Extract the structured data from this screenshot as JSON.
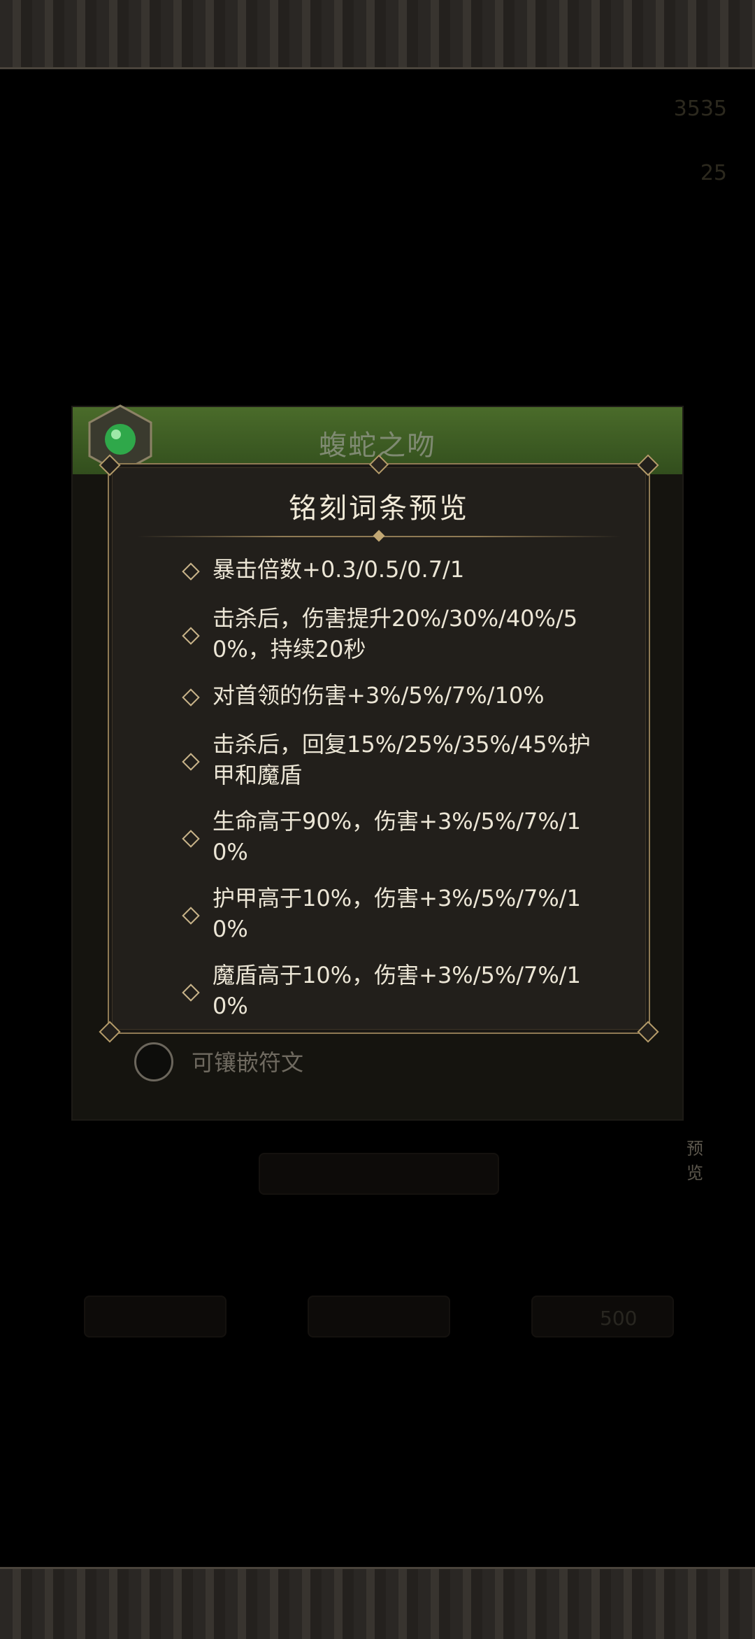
{
  "background": {
    "currency_1": "3535",
    "currency_2": "25",
    "equip_title": "蝮蛇之吻",
    "rune_label": "可镶嵌符文",
    "side_preview_label": "预览",
    "price": "500"
  },
  "popup": {
    "title": "铭刻词条预览",
    "entries": [
      "暴击倍数+0.3/0.5/0.7/1",
      "击杀后，伤害提升20%/30%/40%/50%，持续20秒",
      "对首领的伤害+3%/5%/7%/10%",
      "击杀后，回复15%/25%/35%/45%护甲和魔盾",
      "生命高于90%，伤害+3%/5%/7%/10%",
      "护甲高于10%，伤害+3%/5%/7%/10%",
      "魔盾高于10%，伤害+3%/5%/7%/10%"
    ]
  },
  "colors": {
    "header_green": "#4a6b2a",
    "popup_bg": "#221f1b",
    "popup_border": "#8f7a54",
    "text": "#ece6d6"
  }
}
